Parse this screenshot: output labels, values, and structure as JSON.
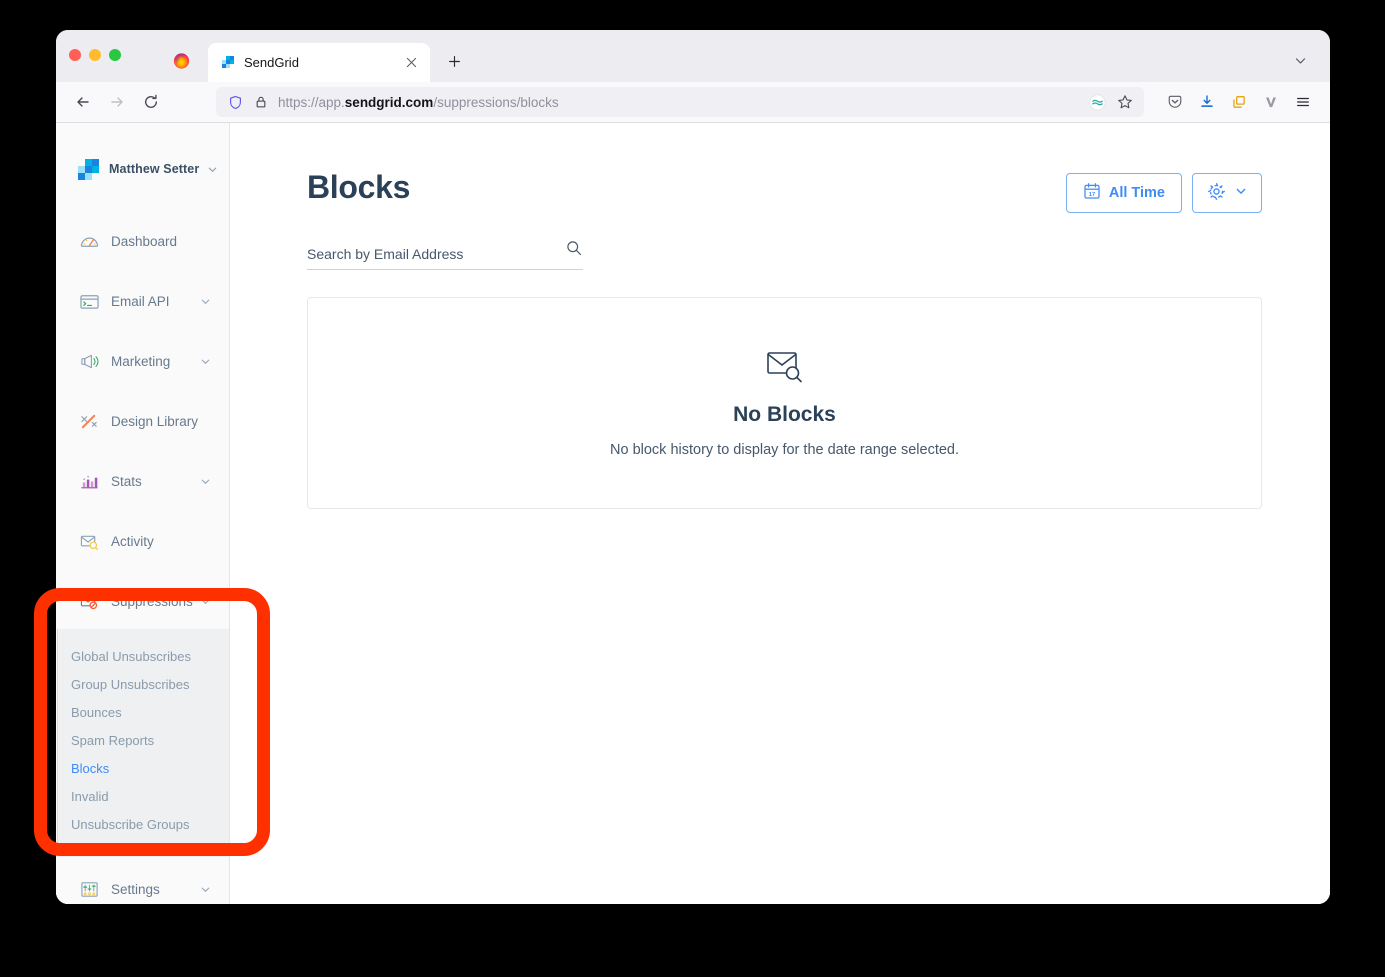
{
  "browser": {
    "name": "firefox",
    "traffic_lights": [
      "close",
      "minimize",
      "maximize"
    ],
    "tab": {
      "title": "SendGrid",
      "favicon": "sendgrid-logo-icon",
      "close_label": "×"
    },
    "new_tab_label": "+",
    "tablist_icon": "chevron-down-icon",
    "nav": {
      "back_icon": "back-arrow-icon",
      "forward_icon": "forward-arrow-icon",
      "reload_icon": "reload-icon"
    },
    "url": {
      "scheme": "https://app.",
      "host": "sendgrid.com",
      "path": "/suppressions/blocks",
      "full": "https://app.sendgrid.com/suppressions/blocks",
      "shield_icon": "shield-icon",
      "lock_icon": "padlock-icon",
      "extension_icon": "extension-icon",
      "bookmark_icon": "star-icon"
    },
    "toolbar_icons": [
      {
        "name": "pocket-icon",
        "color": "#5b5b66"
      },
      {
        "name": "downloads-icon",
        "color": "#0a66d6"
      },
      {
        "name": "container-tabs-icon",
        "color": "#e8a317"
      },
      {
        "name": "vimium-icon",
        "color": "#9a9aa3"
      },
      {
        "name": "app-menu-icon",
        "color": "#2b2a33"
      }
    ]
  },
  "sidebar": {
    "account": {
      "name": "Matthew Setter",
      "logo": "sendgrid-logo-icon",
      "caret_icon": "chevron-down-icon"
    },
    "items": [
      {
        "label": "Dashboard",
        "icon": "gauge-icon",
        "expandable": false
      },
      {
        "label": "Email API",
        "icon": "terminal-icon",
        "expandable": true
      },
      {
        "label": "Marketing",
        "icon": "megaphone-icon",
        "expandable": true
      },
      {
        "label": "Design Library",
        "icon": "pencil-ruler-icon",
        "expandable": false
      },
      {
        "label": "Stats",
        "icon": "bar-chart-icon",
        "expandable": true
      },
      {
        "label": "Activity",
        "icon": "envelope-search-icon",
        "expandable": false
      },
      {
        "label": "Suppressions",
        "icon": "envelope-blocked-icon",
        "expandable": true
      },
      {
        "label": "Settings",
        "icon": "sliders-icon",
        "expandable": true
      }
    ],
    "suppressions_submenu": [
      {
        "label": "Global Unsubscribes",
        "active": false
      },
      {
        "label": "Group Unsubscribes",
        "active": false
      },
      {
        "label": "Bounces",
        "active": false
      },
      {
        "label": "Spam Reports",
        "active": false
      },
      {
        "label": "Blocks",
        "active": true
      },
      {
        "label": "Invalid",
        "active": false
      },
      {
        "label": "Unsubscribe Groups",
        "active": false
      }
    ]
  },
  "main": {
    "title": "Blocks",
    "date_filter": {
      "label": "All Time",
      "icon": "calendar-icon",
      "calendar_day": "17"
    },
    "settings_button": {
      "icon": "gear-icon",
      "caret_icon": "chevron-down-icon"
    },
    "search": {
      "placeholder": "Search by Email Address",
      "value": "",
      "icon": "search-icon"
    },
    "empty_state": {
      "icon": "envelope-search-icon",
      "title": "No Blocks",
      "description": "No block history to display for the date range selected."
    }
  },
  "annotation": {
    "type": "highlight-rectangle",
    "color": "#ff3000",
    "target": "suppressions-menu"
  },
  "colors": {
    "accent_blue": "#3f8cf4",
    "title_navy": "#2b4158",
    "sidebar_bg": "#fafafa",
    "submenu_bg": "#eef0f1",
    "body_text": "#46586c",
    "muted_text": "#8b9bab"
  }
}
